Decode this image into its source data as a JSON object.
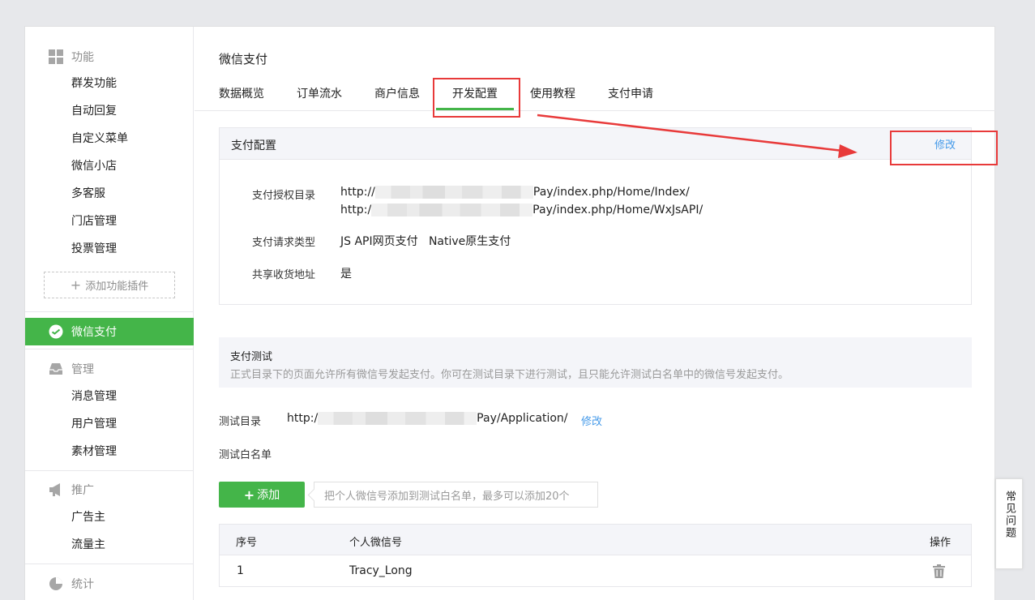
{
  "sidebar": {
    "section_function": "功能",
    "function_items": [
      "群发功能",
      "自动回复",
      "自定义菜单",
      "微信小店",
      "多客服",
      "门店管理",
      "投票管理"
    ],
    "add_plugin": "添加功能插件",
    "active_item": "微信支付",
    "section_manage": "管理",
    "manage_items": [
      "消息管理",
      "用户管理",
      "素材管理"
    ],
    "section_promote": "推广",
    "promote_items": [
      "广告主",
      "流量主"
    ],
    "section_stats": "统计"
  },
  "main": {
    "title": "微信支付",
    "tabs": [
      "数据概览",
      "订单流水",
      "商户信息",
      "开发配置",
      "使用教程",
      "支付申请"
    ],
    "active_tab": "开发配置"
  },
  "pay_config": {
    "header": "支付配置",
    "edit": "修改",
    "auth_dir_label": "支付授权目录",
    "auth_dir_1_prefix": "http://",
    "auth_dir_1_suffix": "Pay/index.php/Home/Index/",
    "auth_dir_2_prefix": "http:/",
    "auth_dir_2_suffix": "Pay/index.php/Home/WxJsAPI/",
    "request_type_label": "支付请求类型",
    "request_type_value": "JS API网页支付   Native原生支付",
    "share_addr_label": "共享收货地址",
    "share_addr_value": "是"
  },
  "pay_test": {
    "header": "支付测试",
    "description": "正式目录下的页面允许所有微信号发起支付。你可在测试目录下进行测试，且只能允许测试白名单中的微信号发起支付。",
    "test_dir_label": "测试目录",
    "test_dir_prefix": "http:/",
    "test_dir_suffix": "Pay/Application/",
    "test_dir_edit": "修改",
    "whitelist_label": "测试白名单",
    "add_button": "添加",
    "add_hint": "把个人微信号添加到测试白名单，最多可以添加20个",
    "table": {
      "columns": [
        "序号",
        "个人微信号",
        "操作"
      ],
      "rows": [
        {
          "index": "1",
          "wechat_id": "Tracy_Long"
        }
      ]
    }
  },
  "faq": "常见问题",
  "colors": {
    "accent_green": "#44b549",
    "link_blue": "#459ae9",
    "annotation_red": "#e83a3a"
  }
}
